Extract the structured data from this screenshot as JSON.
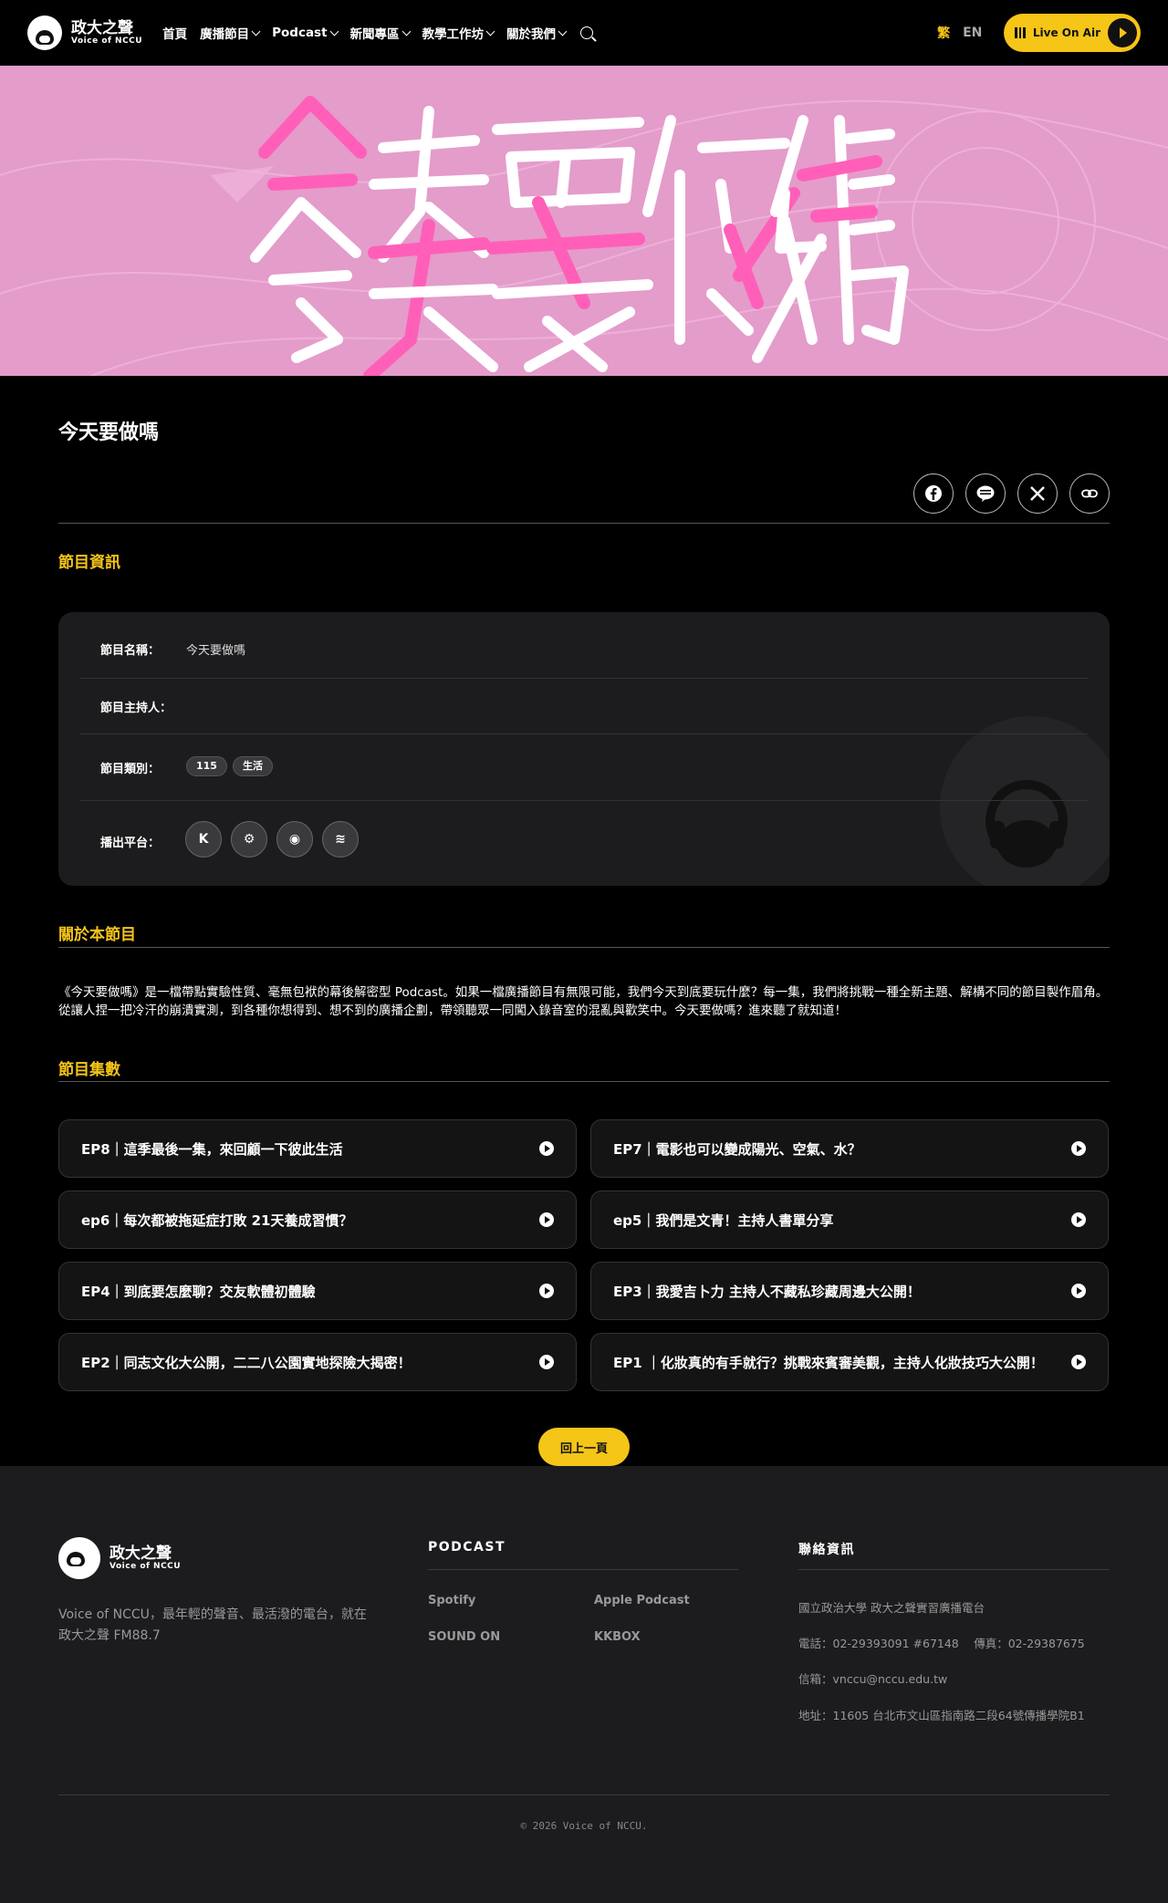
{
  "header": {
    "logo_cn": "政大之聲",
    "logo_en": "Voice of NCCU",
    "nav": [
      {
        "label": "首頁",
        "dropdown": false
      },
      {
        "label": "廣播節目",
        "dropdown": true
      },
      {
        "label": "Podcast",
        "dropdown": true
      },
      {
        "label": "新聞專區",
        "dropdown": true
      },
      {
        "label": "教學工作坊",
        "dropdown": true
      },
      {
        "label": "關於我們",
        "dropdown": true
      }
    ],
    "lang_active": "繁",
    "lang_other": "EN",
    "live_label": "Live On Air"
  },
  "page": {
    "title": "今天要做嗎",
    "share_buttons": [
      "facebook-icon",
      "line-icon",
      "x-icon",
      "link-icon"
    ]
  },
  "info": {
    "section_title": "節目資訊",
    "name_label": "節目名稱：",
    "name_value": "今天要做嗎",
    "host_label": "節目主持人：",
    "category_label": "節目類別：",
    "tags": [
      "115",
      "生活"
    ],
    "platform_label": "播出平台：",
    "platforms": [
      {
        "icon": "kkbox-icon",
        "glyph": "K"
      },
      {
        "icon": "soundon-icon",
        "glyph": "⚙"
      },
      {
        "icon": "apple-podcast-icon",
        "glyph": "◉"
      },
      {
        "icon": "spotify-icon",
        "glyph": "≋"
      }
    ]
  },
  "about": {
    "section_title": "關於本節目",
    "text": "《今天要做嗎》是一檔帶點實驗性質、毫無包袱的幕後解密型 Podcast。如果一檔廣播節目有無限可能，我們今天到底要玩什麼？每一集，我們將挑戰一種全新主題、解構不同的節目製作眉角。從讓人捏一把冷汗的崩潰實測，到各種你想得到、想不到的廣播企劃，帶領聽眾一同闖入錄音室的混亂與歡笑中。今天要做嗎？進來聽了就知道！"
  },
  "episodes": {
    "section_title": "節目集數",
    "items": [
      "EP8｜這季最後一集，來回顧一下彼此生活",
      "EP7｜電影也可以變成陽光、空氣、水？",
      "ep6｜每次都被拖延症打敗 21天養成習慣？",
      "ep5｜我們是文青！主持人書單分享",
      "EP4｜到底要怎麼聊？交友軟體初體驗",
      "EP3｜我愛吉卜力 主持人不藏私珍藏周邊大公開！",
      "EP2｜同志文化大公開，二二八公園實地探險大揭密！",
      "EP1 ｜化妝真的有手就行？挑戰來賓審美觀，主持人化妝技巧大公開！"
    ]
  },
  "back_label": "回上一頁",
  "footer": {
    "logo_cn": "政大之聲",
    "logo_en": "Voice of NCCU",
    "desc": "Voice of NCCU，最年輕的聲音、最活潑的電台，就在政大之聲 FM88.7",
    "podcast_title": "PODCAST",
    "podcast_links": [
      "Spotify",
      "Apple Podcast",
      "SOUND ON",
      "KKBOX"
    ],
    "contact_title": "聯絡資訊",
    "contact_lines": [
      "國立政治大學 政大之聲實習廣播電台",
      "電話：02-29393091 #67148　 傳真：02-29387675",
      "信箱：vnccu@nccu.edu.tw",
      "地址：11605 台北市文山區指南路二段64號傳播學院B1"
    ],
    "copyright": "© 2026 Voice of NCCU."
  },
  "colors": {
    "accent": "#f5c518",
    "banner_bg": "#e49ccb",
    "banner_pink": "#ff5fb8"
  }
}
